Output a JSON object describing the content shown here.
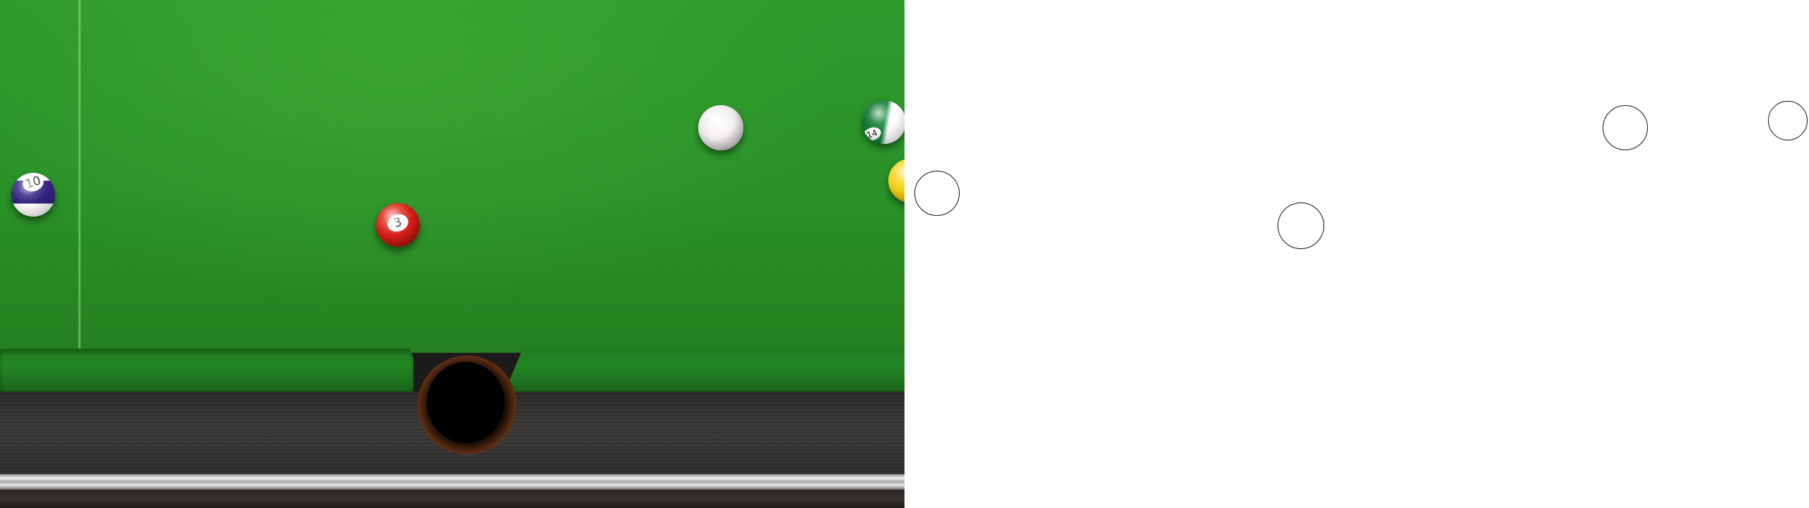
{
  "table": {
    "felt_color": "#2e9a2c",
    "rail_color": "#2f2e2c",
    "pocket_color": "#000000"
  },
  "balls": {
    "cue": {
      "number": "",
      "color": "#f2eef0"
    },
    "three": {
      "number": "3",
      "color": "#d51d16"
    },
    "ten": {
      "number": "10",
      "color": "#31217a"
    },
    "fourteen": {
      "number": "14",
      "color": "#12843a"
    },
    "yellow": {
      "number": "",
      "color": "#f2c80f"
    }
  },
  "outline_panel": {
    "background": "#ffffff",
    "stroke_color": "#111111"
  }
}
